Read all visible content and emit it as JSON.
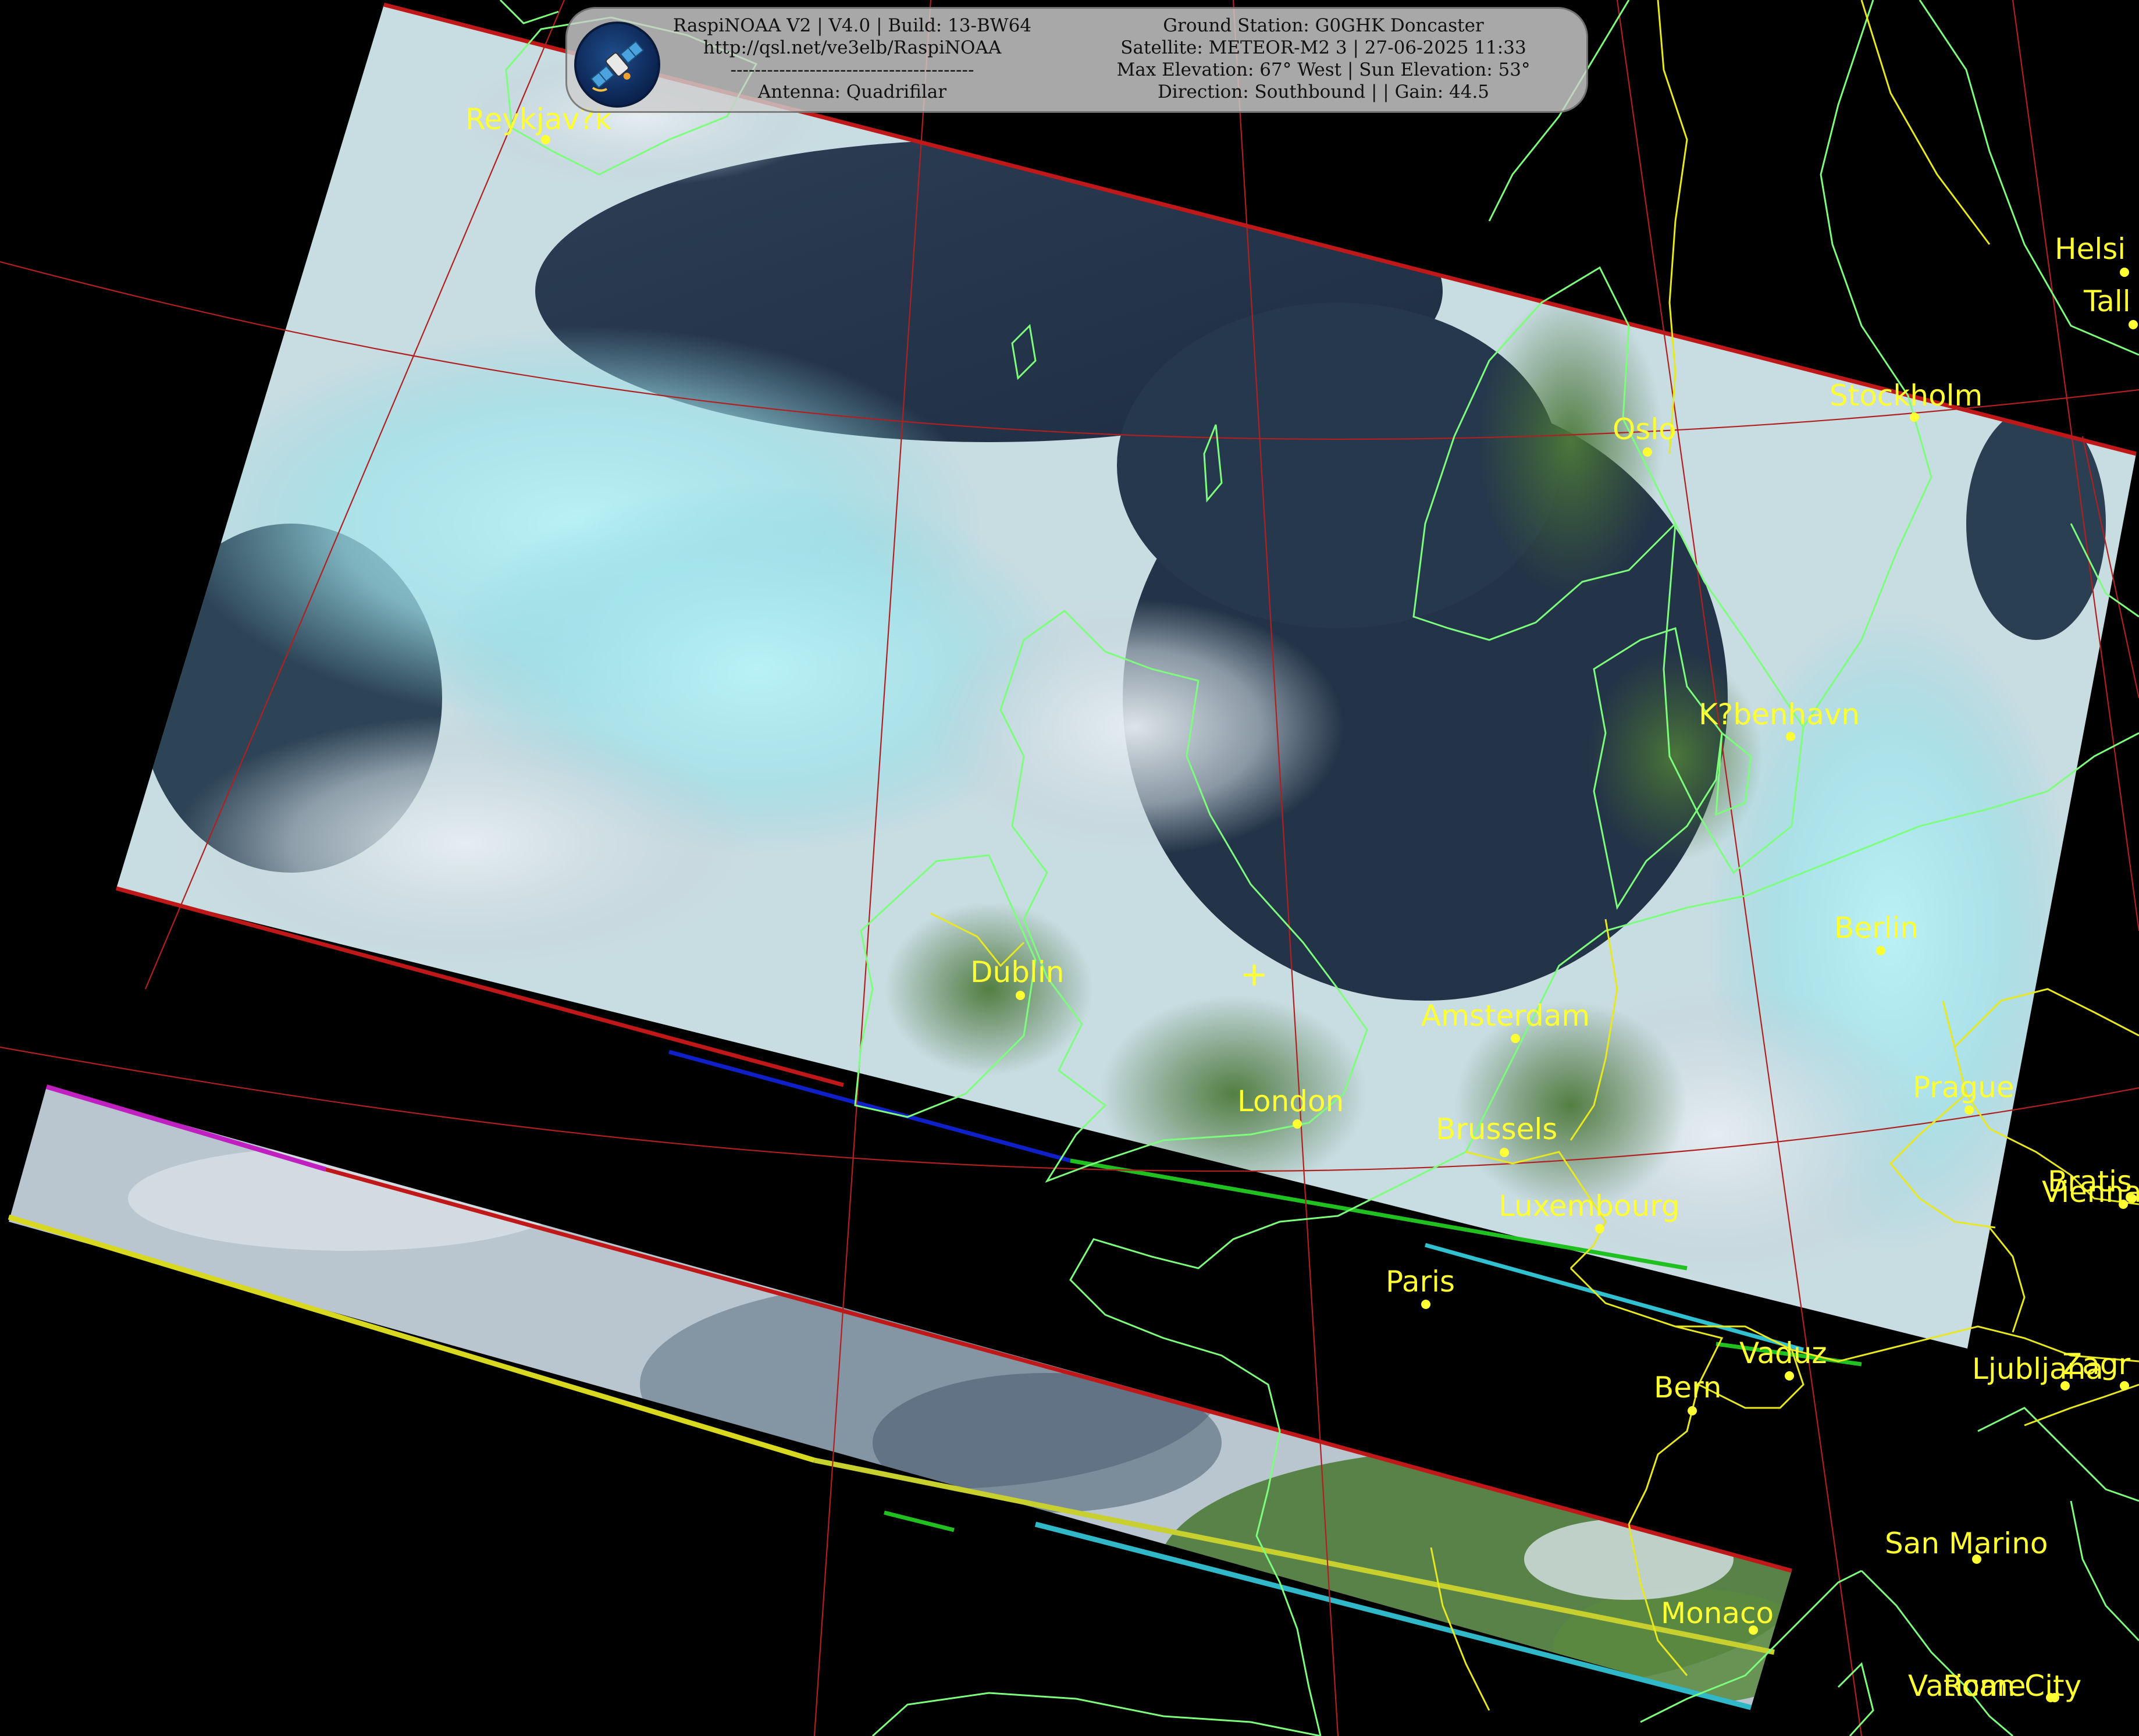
{
  "header": {
    "left_lines": [
      "RaspiNOAA V2 | V4.0 | Build: 13-BW64",
      "http://qsl.net/ve3elb/RaspiNOAA",
      "----------------------------------------",
      "Antenna: Quadrifilar"
    ],
    "right_lines": [
      "Ground Station: G0GHK Doncaster",
      "Satellite: METEOR-M2 3 | 27-06-2025 11:33",
      "Max Elevation: 67° West | Sun Elevation: 53°",
      "Direction: Southbound | | Gain: 44.5"
    ],
    "logo_icon": "satellite-icon"
  },
  "cities": [
    {
      "name": "Reykjav?k"
    },
    {
      "name": "Oslo"
    },
    {
      "name": "Stockholm"
    },
    {
      "name": "Helsi"
    },
    {
      "name": "Tall"
    },
    {
      "name": "K?benhavn"
    },
    {
      "name": "Berlin"
    },
    {
      "name": "Dublin"
    },
    {
      "name": "Amsterdam"
    },
    {
      "name": "London"
    },
    {
      "name": "Brussels"
    },
    {
      "name": "Luxembourg"
    },
    {
      "name": "Prague"
    },
    {
      "name": "Paris"
    },
    {
      "name": "Vaduz"
    },
    {
      "name": "Bern"
    },
    {
      "name": "Ljubljana"
    },
    {
      "name": "Zagr"
    },
    {
      "name": "Vienna"
    },
    {
      "name": "Bratis"
    },
    {
      "name": "San Marino"
    },
    {
      "name": "Monaco"
    },
    {
      "name": "Vatican City"
    },
    {
      "name": "Rome"
    }
  ],
  "ground_station_marker": "plus-icon",
  "colors": {
    "background": "#000000",
    "coastline": "#7dff7d",
    "border": "#e8e820",
    "grid": "#b02020",
    "label": "#ffff33"
  }
}
